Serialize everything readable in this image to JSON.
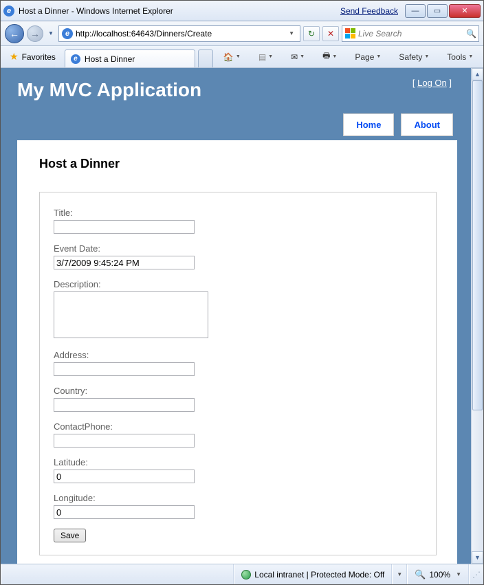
{
  "window": {
    "title": "Host a Dinner - Windows Internet Explorer",
    "send_feedback": "Send Feedback"
  },
  "nav": {
    "url": "http://localhost:64643/Dinners/Create",
    "search_placeholder": "Live Search"
  },
  "cmdbar": {
    "favorites": "Favorites",
    "tab_title": "Host a Dinner",
    "page": "Page",
    "safety": "Safety",
    "tools": "Tools"
  },
  "app": {
    "title": "My MVC Application",
    "logon_label": "Log On",
    "menu": {
      "home": "Home",
      "about": "About"
    },
    "heading": "Host a Dinner",
    "form": {
      "title_label": "Title:",
      "title_value": "",
      "eventdate_label": "Event Date:",
      "eventdate_value": "3/7/2009 9:45:24 PM",
      "description_label": "Description:",
      "description_value": "",
      "address_label": "Address:",
      "address_value": "",
      "country_label": "Country:",
      "country_value": "",
      "contactphone_label": "ContactPhone:",
      "contactphone_value": "",
      "latitude_label": "Latitude:",
      "latitude_value": "0",
      "longitude_label": "Longitude:",
      "longitude_value": "0",
      "save_label": "Save"
    }
  },
  "status": {
    "zone": "Local intranet | Protected Mode: Off",
    "zoom": "100%"
  }
}
